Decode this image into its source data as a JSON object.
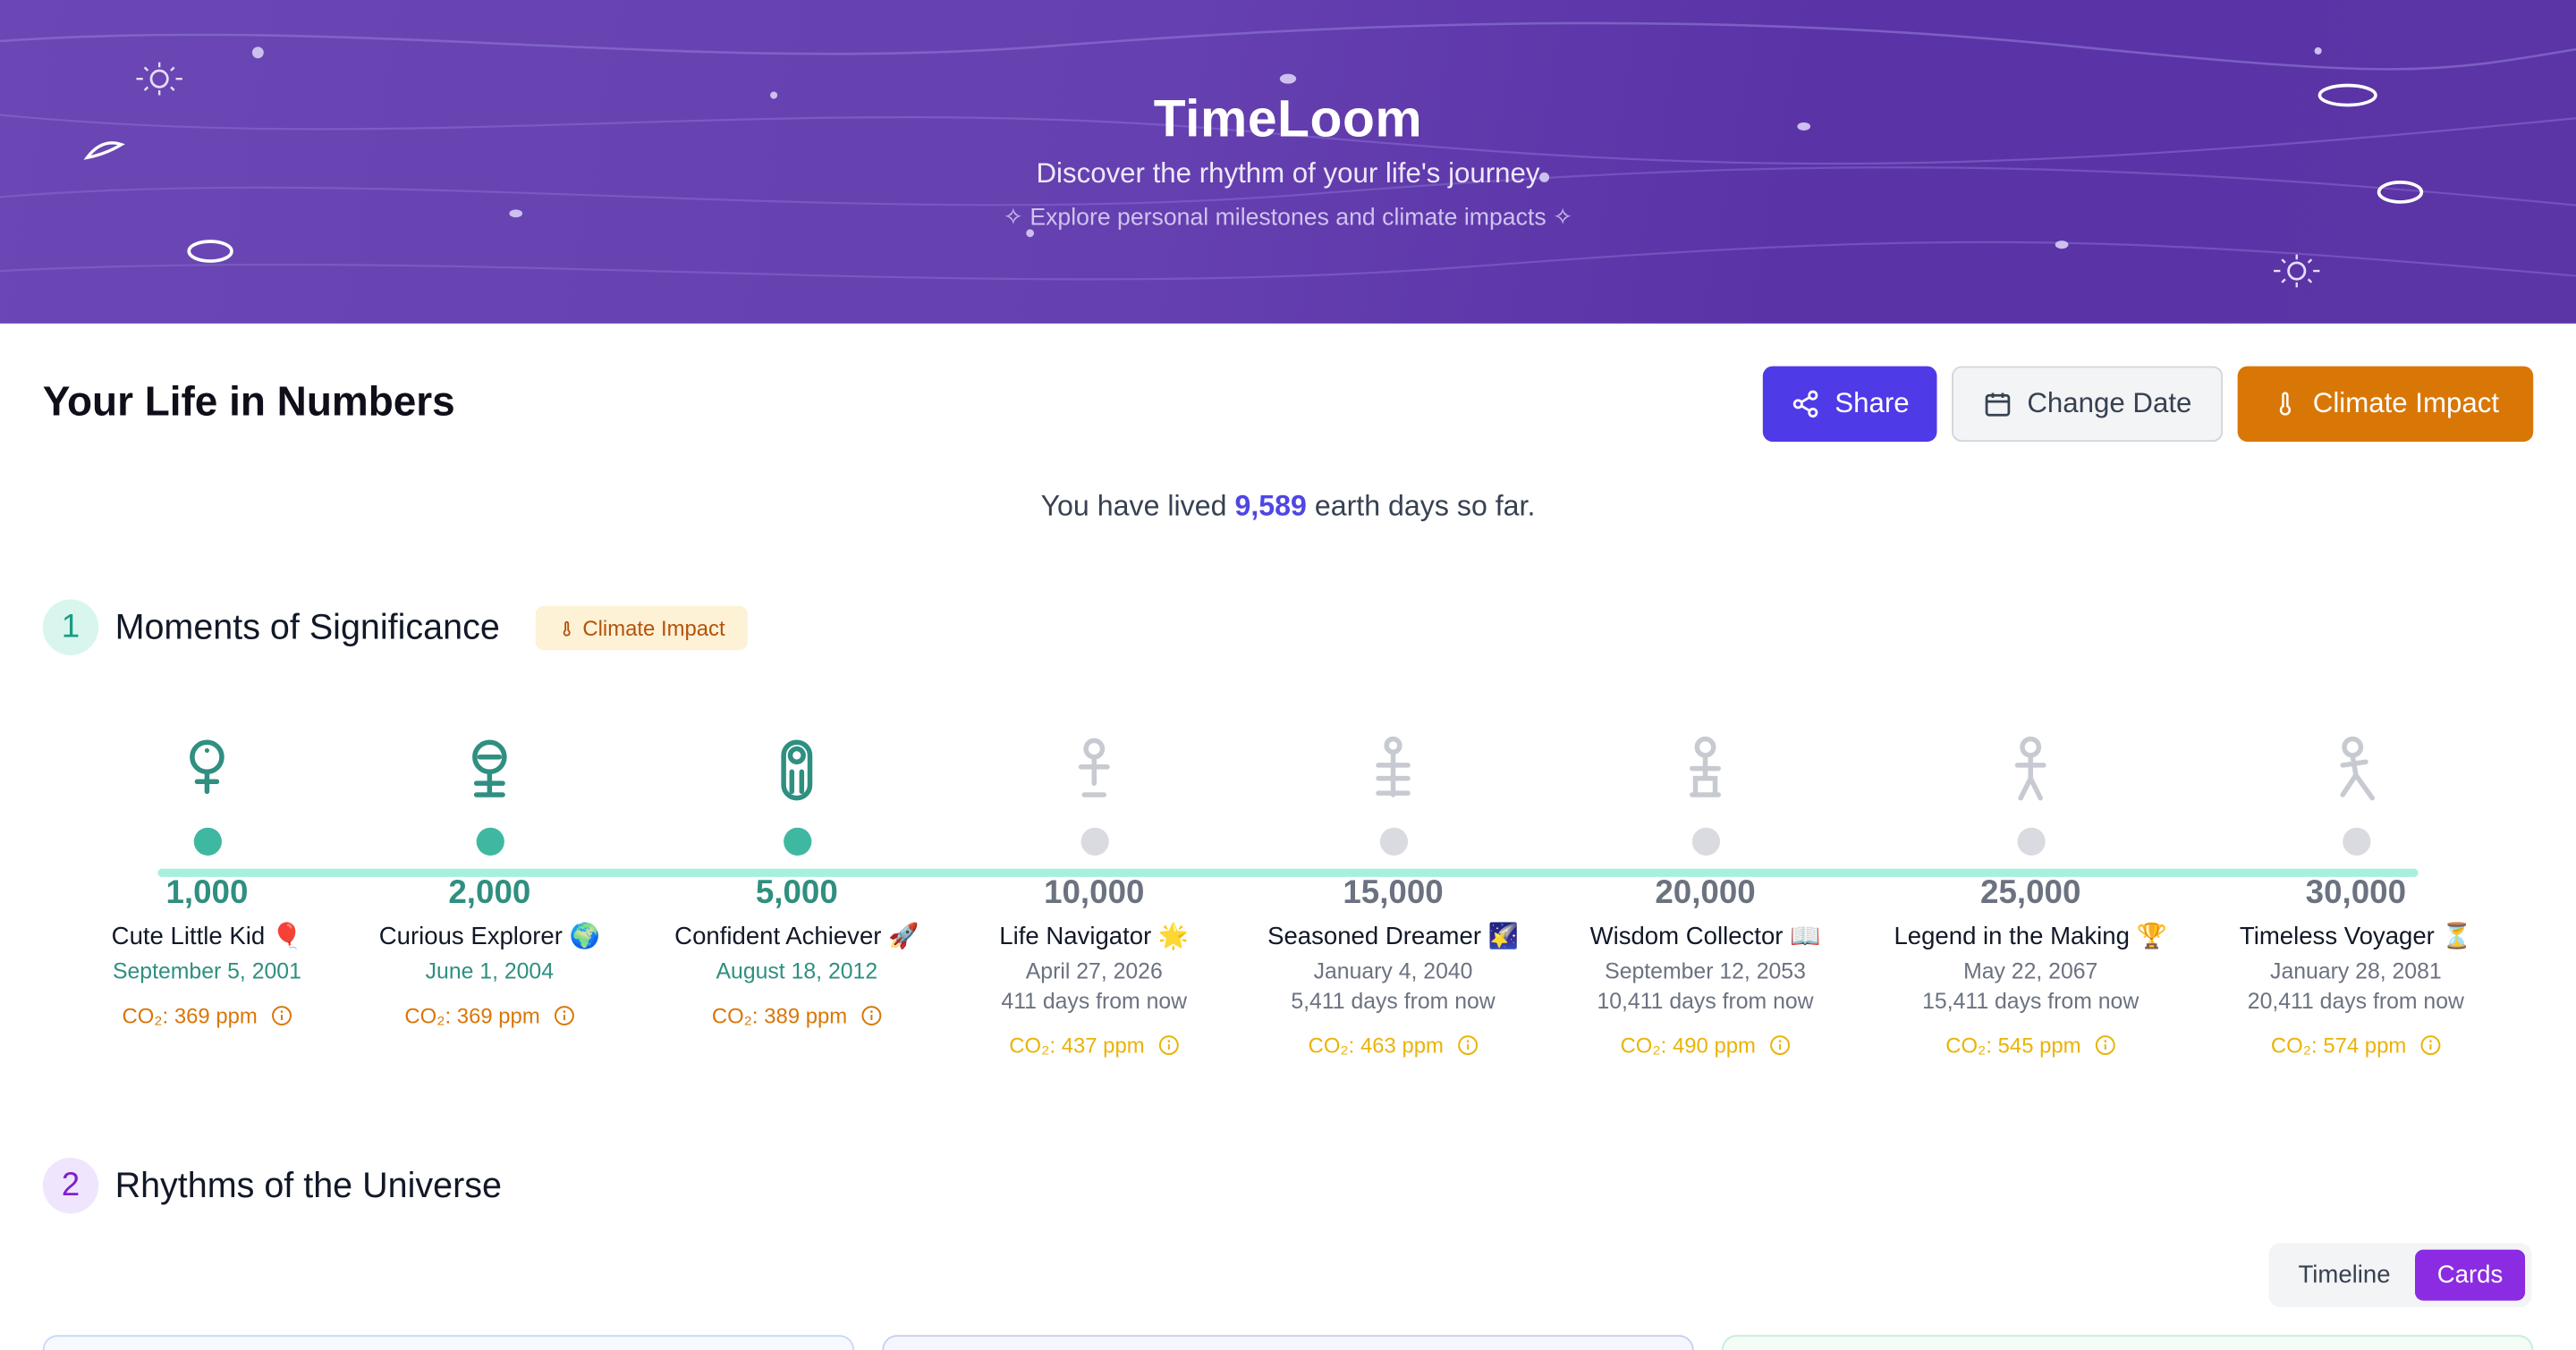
{
  "header": {
    "title": "TimeLoom",
    "subtitle": "Discover the rhythm of your life's journey",
    "tagline": "✧ Explore personal milestones and climate impacts ✧"
  },
  "topbar": {
    "page_title": "Your Life in Numbers",
    "share_label": "Share",
    "change_date_label": "Change Date",
    "climate_label": "Climate Impact"
  },
  "lived": {
    "prefix": "You have lived",
    "days": "9,589",
    "suffix": "earth days so far."
  },
  "section1": {
    "number": "1",
    "title": "Moments of Significance",
    "pill_label": "Climate Impact"
  },
  "milestones": [
    {
      "days": "1,000",
      "name": "Cute Little Kid",
      "emoji": "🎈",
      "date": "September 5, 2001",
      "from_now": "",
      "co2": "369 ppm",
      "status": "past",
      "figure": "baby-figure-icon"
    },
    {
      "days": "2,000",
      "name": "Curious Explorer",
      "emoji": "🌍",
      "date": "June 1, 2004",
      "from_now": "",
      "co2": "369 ppm",
      "status": "past",
      "figure": "child-figure-icon"
    },
    {
      "days": "5,000",
      "name": "Confident Achiever",
      "emoji": "🚀",
      "date": "August 18, 2012",
      "from_now": "",
      "co2": "389 ppm",
      "status": "past",
      "figure": "teen-figure-icon"
    },
    {
      "days": "10,000",
      "name": "Life Navigator",
      "emoji": "🌟",
      "date": "April 27, 2026",
      "from_now": "411 days from now",
      "co2": "437 ppm",
      "status": "future",
      "figure": "adult-figure-icon"
    },
    {
      "days": "15,000",
      "name": "Seasoned Dreamer",
      "emoji": "🌠",
      "date": "January 4, 2040",
      "from_now": "5,411 days from now",
      "co2": "463 ppm",
      "status": "future",
      "figure": "grown-figure-icon"
    },
    {
      "days": "20,000",
      "name": "Wisdom Collector",
      "emoji": "📖",
      "date": "September 12, 2053",
      "from_now": "10,411 days from now",
      "co2": "490 ppm",
      "status": "future",
      "figure": "mature-figure-icon"
    },
    {
      "days": "25,000",
      "name": "Legend in the Making",
      "emoji": "🏆",
      "date": "May 22, 2067",
      "from_now": "15,411 days from now",
      "co2": "545 ppm",
      "status": "future",
      "figure": "elder-figure-icon"
    },
    {
      "days": "30,000",
      "name": "Timeless Voyager",
      "emoji": "⏳",
      "date": "January 28, 2081",
      "from_now": "20,411 days from now",
      "co2": "574 ppm",
      "status": "future",
      "figure": "walking-elder-figure-icon"
    }
  ],
  "co2_prefix": "CO₂:",
  "section2": {
    "number": "2",
    "title": "Rhythms of the Universe"
  },
  "view_toggle": {
    "timeline_label": "Timeline",
    "cards_label": "Cards",
    "selected": "Cards"
  },
  "colors": {
    "accent": "#4f3ae8",
    "climate": "#d97706",
    "teal": "#3fb8a1",
    "purple": "#8b2be2"
  }
}
